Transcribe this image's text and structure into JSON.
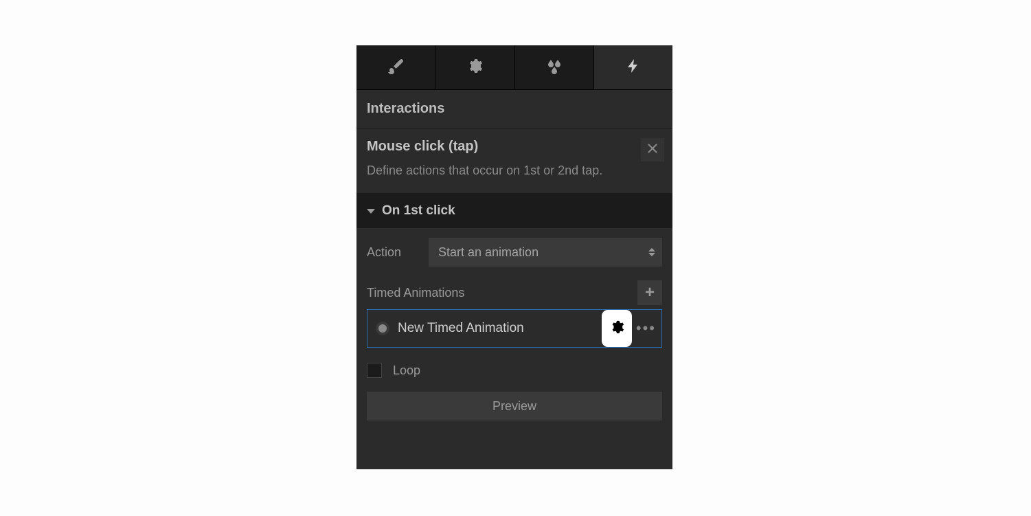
{
  "tabs": {
    "icons": [
      "brush-icon",
      "gear-icon",
      "droplets-icon",
      "lightning-icon"
    ],
    "active_index": 3
  },
  "section_title": "Interactions",
  "trigger": {
    "title": "Mouse click (tap)",
    "description": "Define actions that occur on 1st or 2nd tap."
  },
  "disclosure": {
    "label": "On 1st click",
    "action_label": "Action",
    "action_value": "Start an animation",
    "animations_label": "Timed Animations",
    "animation_items": [
      {
        "name": "New Timed Animation"
      }
    ],
    "loop_label": "Loop",
    "loop_checked": false,
    "preview_label": "Preview"
  }
}
